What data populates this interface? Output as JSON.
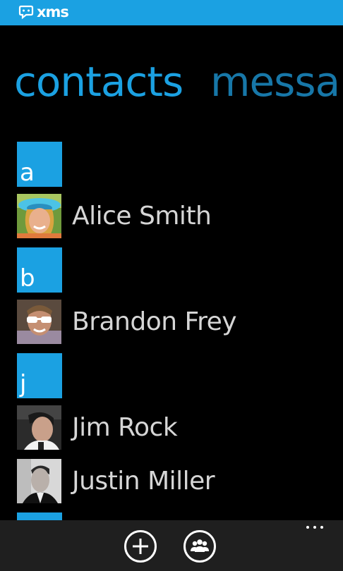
{
  "app": {
    "brand": "xms",
    "accent_color": "#1ba1e2",
    "brand_icon": "chat-bubble-icon"
  },
  "pivot": {
    "active_label": "contacts",
    "next_label": "messa"
  },
  "contacts": {
    "groups": [
      {
        "letter": "a"
      },
      {
        "letter": "b"
      },
      {
        "letter": "j"
      },
      {
        "letter": ""
      }
    ],
    "items": [
      {
        "name": "Alice Smith",
        "avatar": "photo-alice"
      },
      {
        "name": "Brandon Frey",
        "avatar": "photo-brandon"
      },
      {
        "name": "Jim Rock",
        "avatar": "photo-jim"
      },
      {
        "name": "Justin Miller",
        "avatar": "photo-justin"
      }
    ]
  },
  "appbar": {
    "buttons": [
      {
        "icon": "add-icon"
      },
      {
        "icon": "group-icon"
      }
    ],
    "more_icon": "ellipsis-icon"
  }
}
